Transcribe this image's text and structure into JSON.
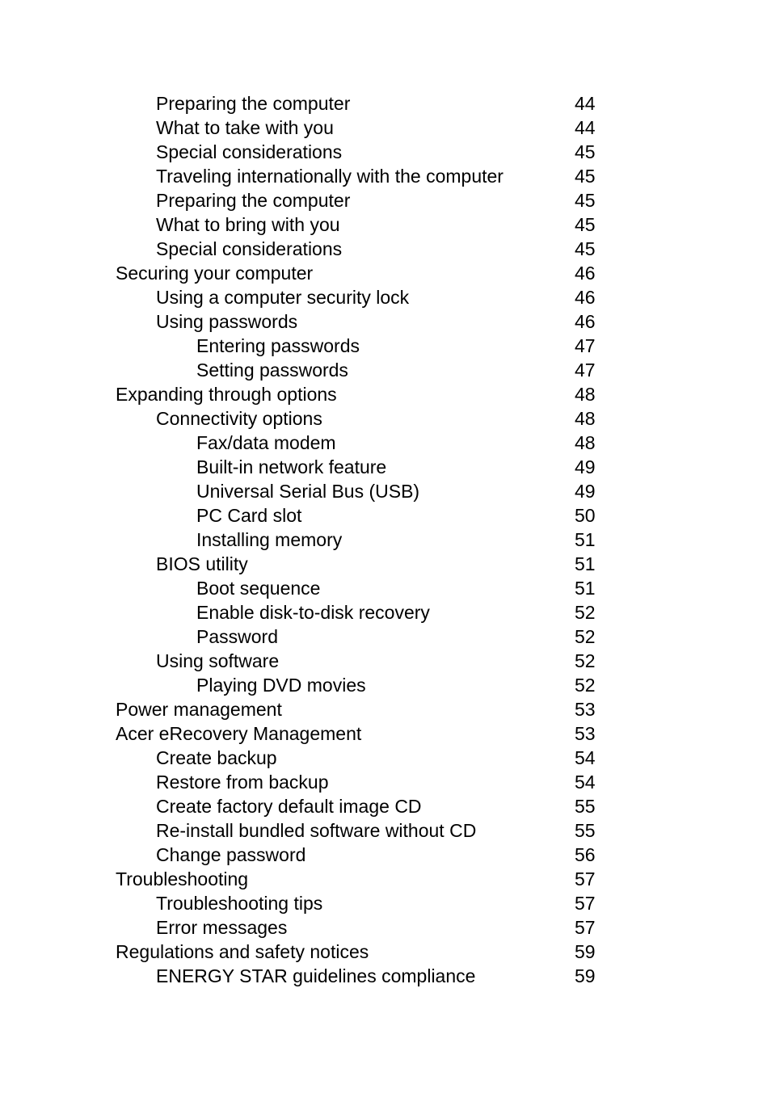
{
  "document": {
    "type": "table-of-contents",
    "page_background": "#ffffff",
    "text_color": "#000000"
  },
  "toc": {
    "entries": [
      {
        "title": "Preparing the computer",
        "page": "44",
        "level": 1
      },
      {
        "title": "What to take with you",
        "page": "44",
        "level": 1
      },
      {
        "title": "Special considerations",
        "page": "45",
        "level": 1
      },
      {
        "title": "Traveling internationally with the computer",
        "page": "45",
        "level": 1
      },
      {
        "title": "Preparing the computer",
        "page": "45",
        "level": 1
      },
      {
        "title": "What to bring with you",
        "page": "45",
        "level": 1
      },
      {
        "title": "Special considerations",
        "page": "45",
        "level": 1
      },
      {
        "title": "Securing your computer",
        "page": "46",
        "level": 0
      },
      {
        "title": "Using a computer security lock",
        "page": "46",
        "level": 1
      },
      {
        "title": "Using passwords",
        "page": "46",
        "level": 1
      },
      {
        "title": "Entering passwords",
        "page": "47",
        "level": 2
      },
      {
        "title": "Setting passwords",
        "page": "47",
        "level": 2
      },
      {
        "title": "Expanding through options",
        "page": "48",
        "level": 0
      },
      {
        "title": "Connectivity options",
        "page": "48",
        "level": 1
      },
      {
        "title": "Fax/data modem",
        "page": "48",
        "level": 2
      },
      {
        "title": "Built-in network feature",
        "page": "49",
        "level": 2
      },
      {
        "title": "Universal Serial Bus (USB)",
        "page": "49",
        "level": 2
      },
      {
        "title": "PC Card slot",
        "page": "50",
        "level": 2
      },
      {
        "title": "Installing memory",
        "page": "51",
        "level": 2
      },
      {
        "title": "BIOS utility",
        "page": "51",
        "level": 1
      },
      {
        "title": "Boot sequence",
        "page": "51",
        "level": 2
      },
      {
        "title": "Enable disk-to-disk recovery",
        "page": "52",
        "level": 2
      },
      {
        "title": "Password",
        "page": "52",
        "level": 2
      },
      {
        "title": "Using software",
        "page": "52",
        "level": 1
      },
      {
        "title": "Playing DVD movies",
        "page": "52",
        "level": 2
      },
      {
        "title": "Power management",
        "page": "53",
        "level": 0
      },
      {
        "title": "Acer eRecovery Management",
        "page": "53",
        "level": 0
      },
      {
        "title": "Create backup",
        "page": "54",
        "level": 1
      },
      {
        "title": "Restore from backup",
        "page": "54",
        "level": 1
      },
      {
        "title": "Create factory default image CD",
        "page": "55",
        "level": 1
      },
      {
        "title": "Re-install bundled software without CD",
        "page": "55",
        "level": 1
      },
      {
        "title": "Change password",
        "page": "56",
        "level": 1
      },
      {
        "title": "Troubleshooting",
        "page": "57",
        "level": 0
      },
      {
        "title": "Troubleshooting tips",
        "page": "57",
        "level": 1
      },
      {
        "title": "Error messages",
        "page": "57",
        "level": 1
      },
      {
        "title": "Regulations and safety notices",
        "page": "59",
        "level": 0
      },
      {
        "title": "ENERGY STAR guidelines compliance",
        "page": "59",
        "level": 1
      }
    ]
  }
}
